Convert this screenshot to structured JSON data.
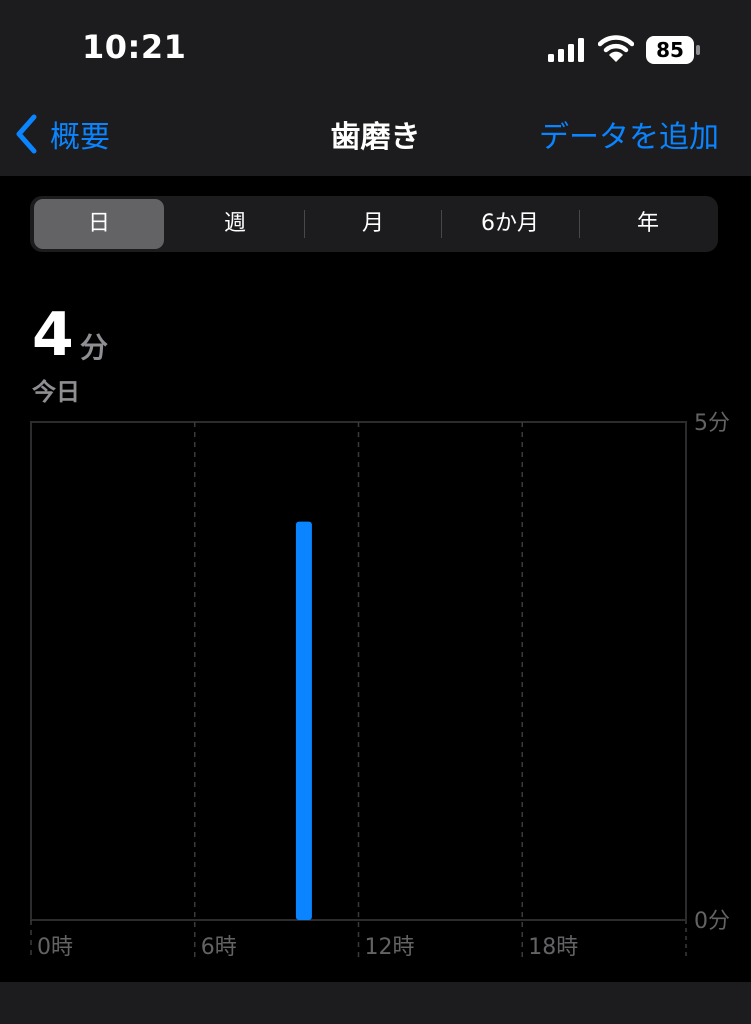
{
  "status_bar": {
    "time": "10:21",
    "battery": "85",
    "icons": [
      "cellular-signal-icon",
      "wifi-icon",
      "battery-icon"
    ]
  },
  "nav": {
    "back_label": "概要",
    "title": "歯磨き",
    "add_label": "データを追加"
  },
  "segments": {
    "items": [
      "日",
      "週",
      "月",
      "6か月",
      "年"
    ],
    "selected": "日"
  },
  "summary": {
    "value": "4",
    "unit": "分",
    "period": "今日"
  },
  "colors": {
    "accent": "#0a84ff",
    "bar": "#0a84ff",
    "background": "#000000",
    "panel": "#1c1c1e"
  },
  "chart_data": {
    "type": "bar",
    "x_tick_labels": [
      "0時",
      "6時",
      "12時",
      "18時"
    ],
    "y_tick_labels": [
      "5分",
      "0分"
    ],
    "ylim": [
      0,
      5
    ],
    "xlim": [
      0,
      24
    ],
    "grid": "vertical dashed every 6 hours",
    "points": [
      {
        "hour": 10,
        "minutes": 4
      }
    ]
  }
}
